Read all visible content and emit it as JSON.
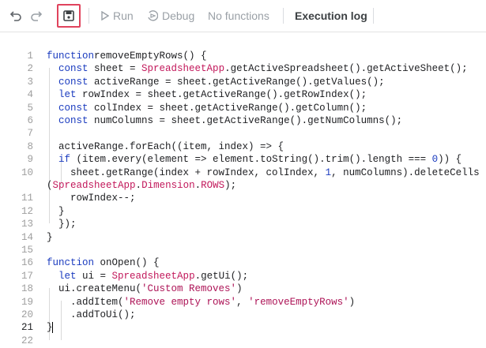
{
  "toolbar": {
    "run_label": "Run",
    "debug_label": "Debug",
    "functions_label": "No functions",
    "execution_log_label": "Execution log"
  },
  "editor": {
    "lines": [
      {
        "num": "1",
        "segs": [
          [
            "kw",
            "function"
          ],
          [
            "",
            "removeEmptyRows() {"
          ]
        ]
      },
      {
        "num": "2",
        "segs": [
          [
            "",
            "  "
          ],
          [
            "kw",
            "const"
          ],
          [
            "",
            " sheet = "
          ],
          [
            "cls",
            "SpreadsheetApp"
          ],
          [
            "",
            ".getActiveSpreadsheet().getActiveSheet();"
          ]
        ]
      },
      {
        "num": "3",
        "segs": [
          [
            "",
            "  "
          ],
          [
            "kw",
            "const"
          ],
          [
            "",
            " activeRange = sheet.getActiveRange().getValues();"
          ]
        ]
      },
      {
        "num": "4",
        "segs": [
          [
            "",
            "  "
          ],
          [
            "kw",
            "let"
          ],
          [
            "",
            " rowIndex = sheet.getActiveRange().getRowIndex();"
          ]
        ]
      },
      {
        "num": "5",
        "segs": [
          [
            "",
            "  "
          ],
          [
            "kw",
            "const"
          ],
          [
            "",
            " colIndex = sheet.getActiveRange().getColumn();"
          ]
        ]
      },
      {
        "num": "6",
        "segs": [
          [
            "",
            "  "
          ],
          [
            "kw",
            "const"
          ],
          [
            "",
            " numColumns = sheet.getActiveRange().getNumColumns();"
          ]
        ]
      },
      {
        "num": "7",
        "segs": []
      },
      {
        "num": "8",
        "segs": [
          [
            "",
            "  activeRange.forEach((item, index) => {"
          ]
        ]
      },
      {
        "num": "9",
        "segs": [
          [
            "",
            "  "
          ],
          [
            "kw",
            "if"
          ],
          [
            "",
            " (item.every(element => element.toString().trim().length === "
          ],
          [
            "num",
            "0"
          ],
          [
            "",
            ")) {"
          ]
        ]
      },
      {
        "num": "10",
        "segs": [
          [
            "",
            "    sheet.getRange(index + rowIndex, colIndex, "
          ],
          [
            "num",
            "1"
          ],
          [
            "",
            ", numColumns).deleteCells"
          ]
        ]
      },
      {
        "num": "",
        "segs": [
          [
            "",
            "("
          ],
          [
            "cls",
            "SpreadsheetApp"
          ],
          [
            "",
            "."
          ],
          [
            "cls",
            "Dimension"
          ],
          [
            "",
            "."
          ],
          [
            "cls",
            "ROWS"
          ],
          [
            "",
            ");"
          ]
        ]
      },
      {
        "num": "11",
        "segs": [
          [
            "",
            "    rowIndex--;"
          ]
        ]
      },
      {
        "num": "12",
        "segs": [
          [
            "",
            "  }"
          ]
        ]
      },
      {
        "num": "13",
        "segs": [
          [
            "",
            "  });"
          ]
        ]
      },
      {
        "num": "14",
        "segs": [
          [
            "",
            "}"
          ]
        ]
      },
      {
        "num": "15",
        "segs": []
      },
      {
        "num": "16",
        "segs": [
          [
            "kw",
            "function"
          ],
          [
            "",
            " onOpen() {"
          ]
        ]
      },
      {
        "num": "17",
        "segs": [
          [
            "",
            "  "
          ],
          [
            "kw",
            "let"
          ],
          [
            "",
            " ui = "
          ],
          [
            "cls",
            "SpreadsheetApp"
          ],
          [
            "",
            ".getUi();"
          ]
        ]
      },
      {
        "num": "18",
        "segs": [
          [
            "",
            "  ui.createMenu("
          ],
          [
            "str",
            "'Custom Removes'"
          ],
          [
            "",
            ")"
          ]
        ]
      },
      {
        "num": "19",
        "segs": [
          [
            "",
            "    .addItem("
          ],
          [
            "str",
            "'Remove empty rows'"
          ],
          [
            "",
            ", "
          ],
          [
            "str",
            "'removeEmptyRows'"
          ],
          [
            "",
            ")"
          ]
        ]
      },
      {
        "num": "20",
        "segs": [
          [
            "",
            "    .addToUi();"
          ]
        ]
      },
      {
        "num": "21",
        "segs": [
          [
            "",
            "}"
          ]
        ],
        "active": true
      },
      {
        "num": "22",
        "segs": []
      }
    ]
  }
}
